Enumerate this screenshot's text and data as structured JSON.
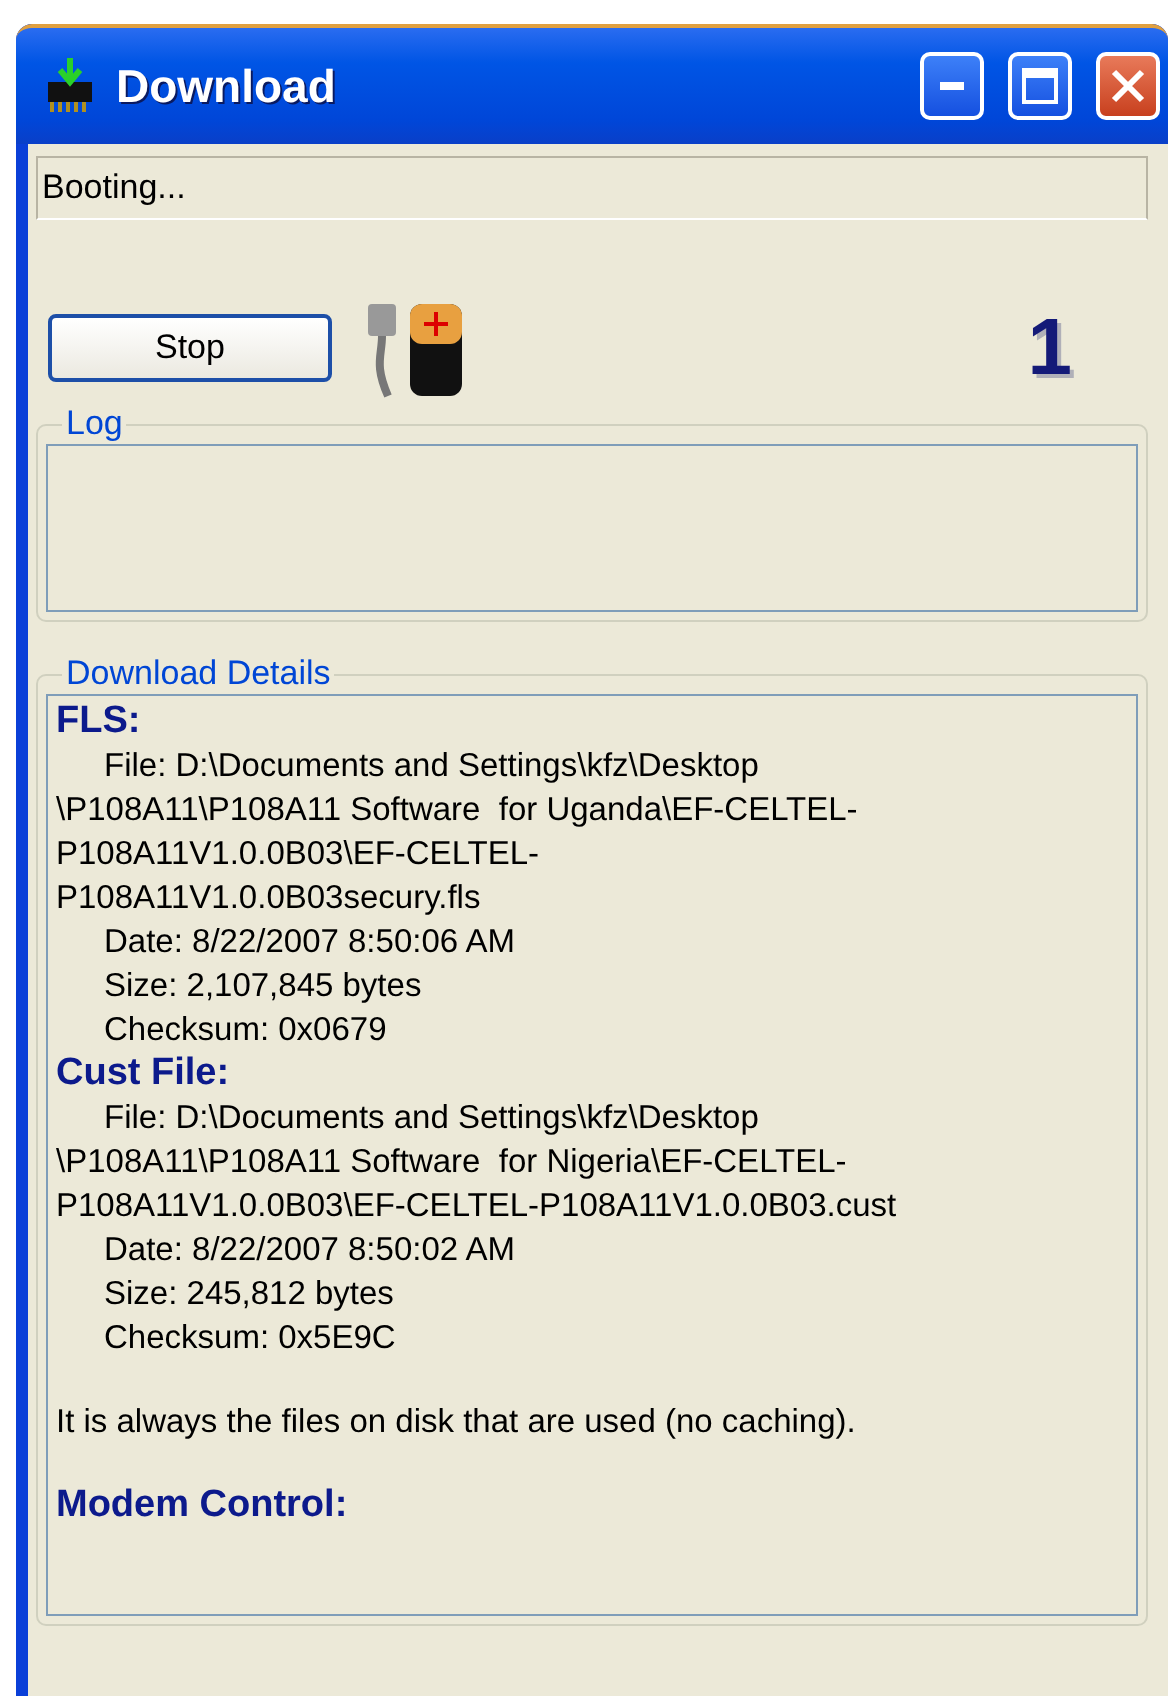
{
  "window": {
    "title": "Download"
  },
  "status": {
    "value": "Booting..."
  },
  "stop_button": {
    "label": "Stop"
  },
  "counter": "1",
  "log": {
    "title": "Log"
  },
  "details": {
    "title": "Download Details",
    "blocks": [
      {
        "kind": "heading",
        "text": "FLS:"
      },
      {
        "kind": "field",
        "lines": [
          "File: D:\\Documents and Settings\\kfz\\Desktop",
          "\\P108A11\\P108A11 Software  for Uganda\\EF-CELTEL-",
          "P108A11V1.0.0B03\\EF-CELTEL-",
          "P108A11V1.0.0B03secury.fls"
        ]
      },
      {
        "kind": "field",
        "lines": [
          "Date: 8/22/2007 8:50:06 AM"
        ]
      },
      {
        "kind": "field",
        "lines": [
          "Size: 2,107,845 bytes"
        ]
      },
      {
        "kind": "field",
        "lines": [
          "Checksum: 0x0679"
        ]
      },
      {
        "kind": "heading",
        "text": "Cust File:"
      },
      {
        "kind": "field",
        "lines": [
          "File: D:\\Documents and Settings\\kfz\\Desktop",
          "\\P108A11\\P108A11 Software  for Nigeria\\EF-CELTEL-",
          "P108A11V1.0.0B03\\EF-CELTEL-P108A11V1.0.0B03.cust"
        ]
      },
      {
        "kind": "field",
        "lines": [
          "Date: 8/22/2007 8:50:02 AM"
        ]
      },
      {
        "kind": "field",
        "lines": [
          "Size: 245,812 bytes"
        ]
      },
      {
        "kind": "field",
        "lines": [
          "Checksum: 0x5E9C"
        ]
      },
      {
        "kind": "note",
        "text": "It is always the files on disk that are used (no caching)."
      },
      {
        "kind": "heading",
        "text": "Modem Control:"
      }
    ]
  }
}
